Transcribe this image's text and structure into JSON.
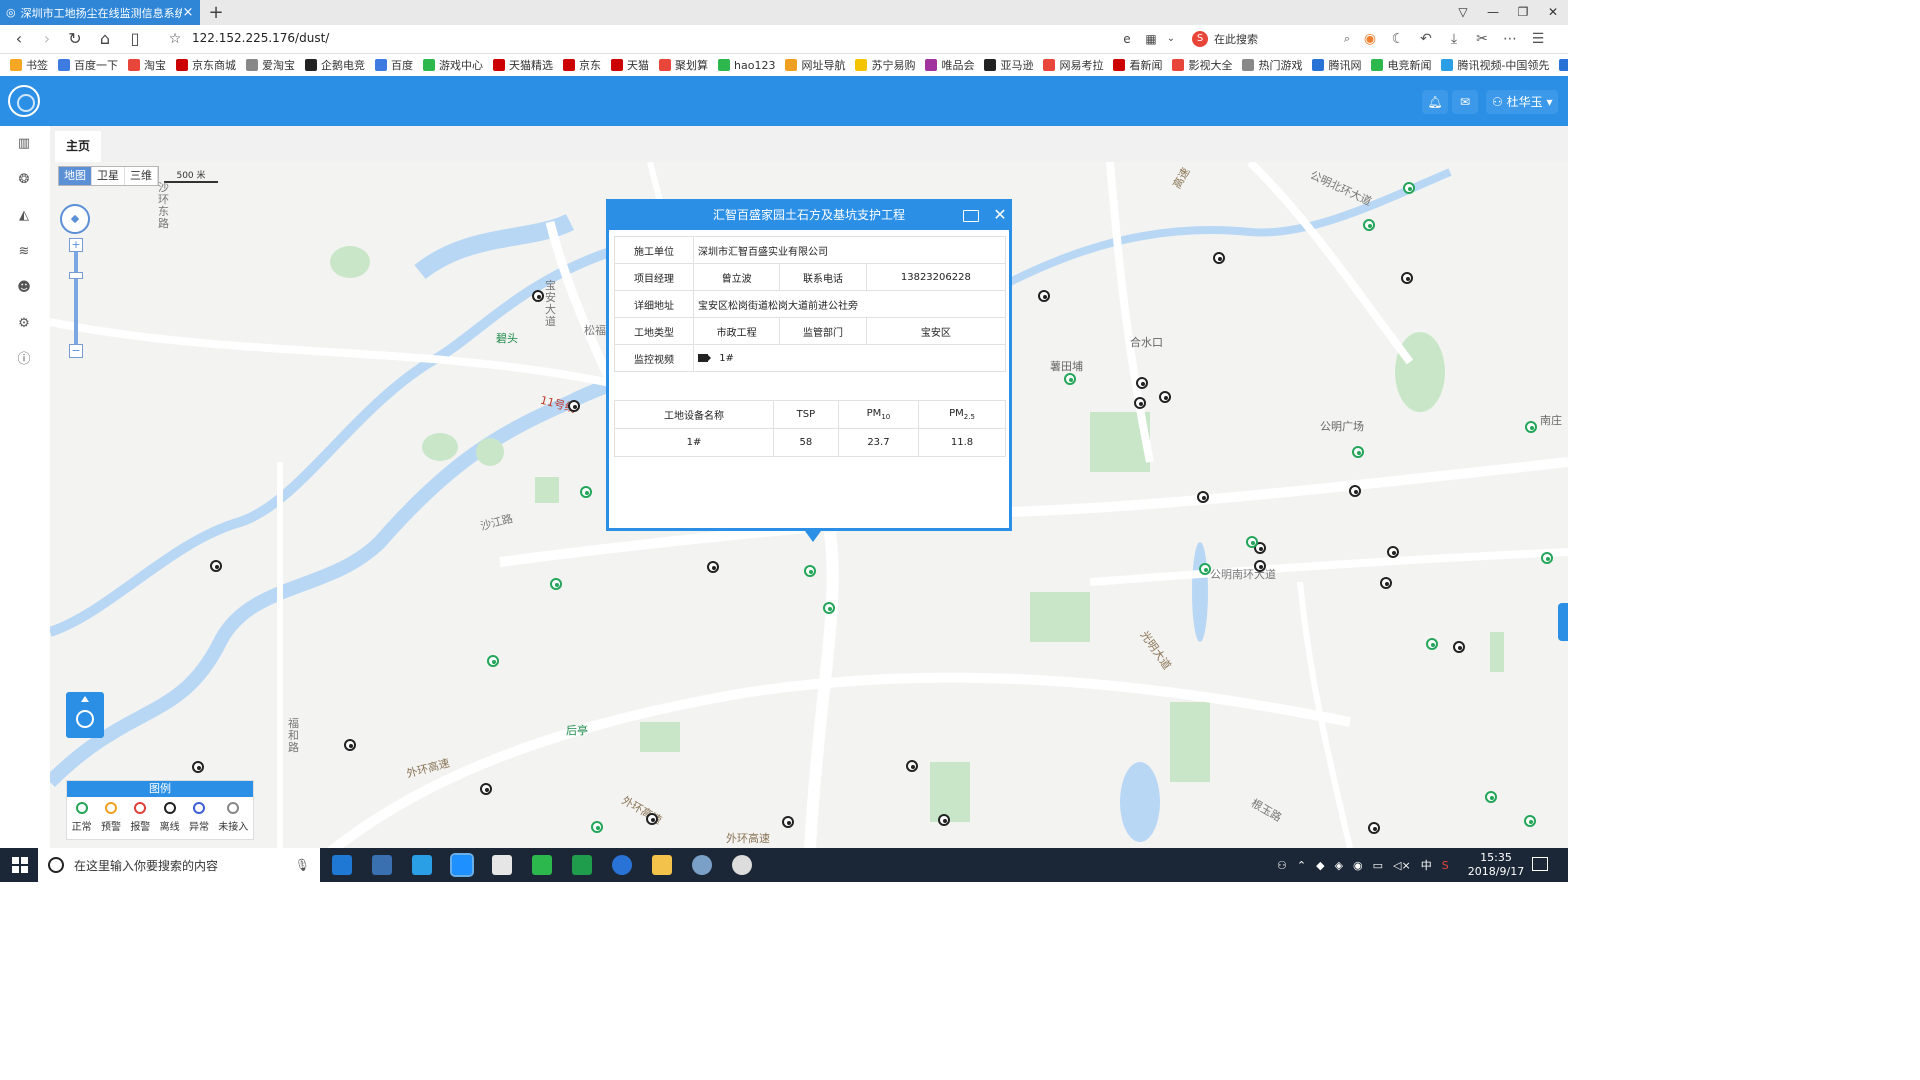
{
  "browser": {
    "tab_title": "深圳市工地扬尘在线监测信息系统",
    "tab_close": "×",
    "new_tab": "+",
    "url": "122.152.225.176/dust/",
    "search_placeholder": "在此搜索",
    "search_logo": "S",
    "bookmarks": [
      "书签",
      "百度一下",
      "淘宝",
      "京东商城",
      "爱淘宝",
      "企鹅电竞",
      "百度",
      "游戏中心",
      "天猫精选",
      "京东",
      "天猫",
      "聚划算",
      "hao123",
      "网址导航",
      "苏宁易购",
      "唯品会",
      "亚马逊",
      "网易考拉",
      "看新闻",
      "影视大全",
      "热门游戏",
      "腾讯网",
      "电竞新闻",
      "腾讯视频-中国领先",
      "上网导"
    ]
  },
  "header": {
    "user_name": "杜华玉"
  },
  "tabs": {
    "home": "主页"
  },
  "map": {
    "map_types": [
      "地图",
      "卫星",
      "三维"
    ],
    "scale": "500 米",
    "zoom_in": "+",
    "zoom_out": "−",
    "labels": {
      "shahuan": "沙环东路",
      "baoan": "宝安大道",
      "songfu": "松福",
      "junshan": "碧头",
      "line11": "11号线",
      "shajiang": "沙江路",
      "gongming_north": "公明北环大道",
      "heshuikou": "合水口",
      "lutianpu": "薯田埔",
      "gongming_plaza": "公明广场",
      "nanyan": "南庄",
      "gongming_south": "公明南环大道",
      "guangming": "光明大道",
      "fuhe": "福和路",
      "houting": "后亭",
      "waihuan1": "外环高速",
      "waihuan2": "外环高速",
      "waihuan3": "外环高速",
      "genyu": "根玉路",
      "gaosu": "高速"
    }
  },
  "legend": {
    "title": "图例",
    "items": [
      "正常",
      "预警",
      "报警",
      "离线",
      "异常",
      "未接入"
    ],
    "colors": [
      "#23a55a",
      "#f0a020",
      "#e0403a",
      "#222222",
      "#3d5fd6",
      "#888888"
    ]
  },
  "popup": {
    "title": "汇智百盛家园土石方及基坑支护工程",
    "close": "✕",
    "rows": {
      "unit_label": "施工单位",
      "unit_value": "深圳市汇智百盛实业有限公司",
      "manager_label": "项目经理",
      "manager_value": "曾立波",
      "phone_label": "联系电话",
      "phone_value": "13823206228",
      "address_label": "详细地址",
      "address_value": "宝安区松岗街道松岗大道前进公社旁",
      "type_label": "工地类型",
      "type_value": "市政工程",
      "dept_label": "监管部门",
      "dept_value": "宝安区",
      "video_label": "监控视频",
      "video_value": "1#"
    },
    "device_table": {
      "headers": [
        "工地设备名称",
        "TSP",
        "PM10",
        "PM2.5"
      ],
      "row": [
        "1#",
        "58",
        "23.7",
        "11.8"
      ]
    }
  },
  "taskbar": {
    "search_placeholder": "在这里输入你要搜索的内容",
    "ime": "中",
    "time": "15:35",
    "date": "2018/9/17"
  }
}
